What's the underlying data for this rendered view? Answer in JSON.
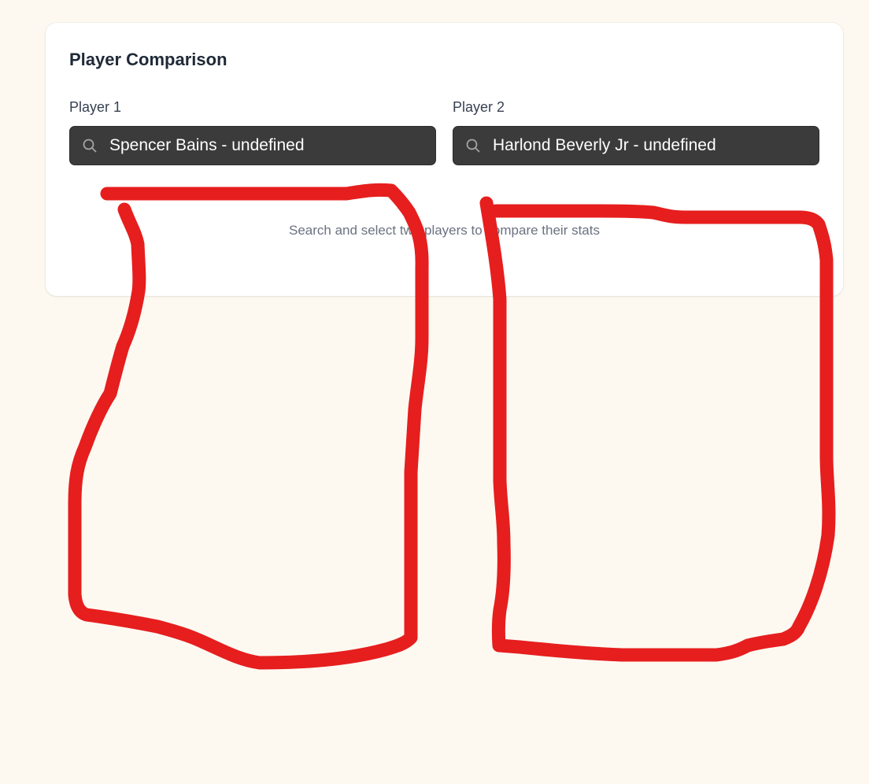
{
  "card": {
    "title": "Player Comparison",
    "player1": {
      "label": "Player 1",
      "value": "Spencer Bains - undefined",
      "icon": "search-icon"
    },
    "player2": {
      "label": "Player 2",
      "value": "Harlond Beverly Jr - undefined",
      "icon": "search-icon"
    },
    "empty_hint": "Search and select two players to compare their stats"
  },
  "colors": {
    "page_background": "#fdf9f1",
    "card_background": "#ffffff",
    "input_background": "#3b3b3b",
    "annotation_red": "#e61e1e"
  }
}
